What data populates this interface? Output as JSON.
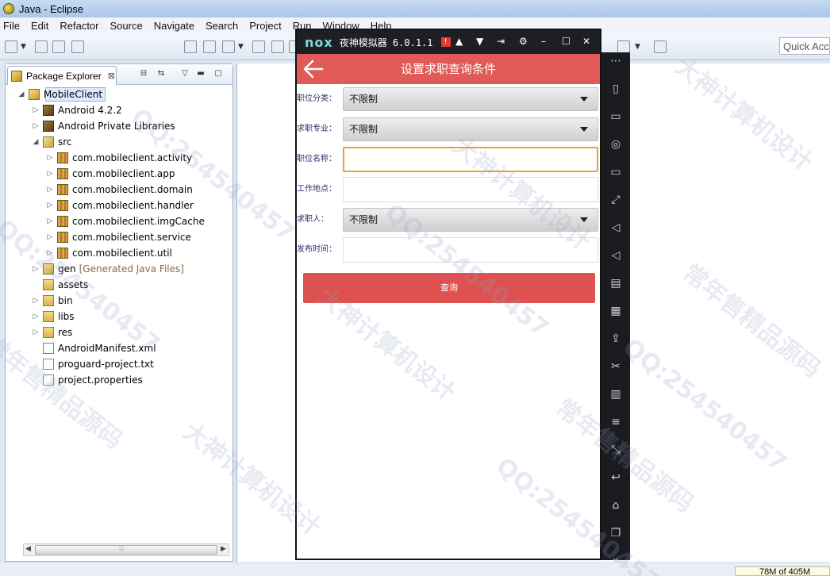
{
  "eclipse": {
    "window_title": "Java - Eclipse",
    "menu": [
      "File",
      "Edit",
      "Refactor",
      "Source",
      "Navigate",
      "Search",
      "Project",
      "Run",
      "Window",
      "Help"
    ],
    "quick_access_placeholder": "Quick Access",
    "package_explorer": {
      "tab_label": "Package Explorer",
      "close_glyph": "⊠",
      "tree": [
        {
          "label": "MobileClient",
          "icon": "project-icon",
          "twisty": "◢",
          "indent": 0
        },
        {
          "label": "Android 4.2.2",
          "icon": "library-icon",
          "twisty": "▷",
          "indent": 1
        },
        {
          "label": "Android Private Libraries",
          "icon": "library-icon",
          "twisty": "▷",
          "indent": 1
        },
        {
          "label": "src",
          "icon": "source-folder-icon",
          "twisty": "◢",
          "indent": 1
        },
        {
          "label": "com.mobileclient.activity",
          "icon": "package-icon",
          "twisty": "▷",
          "indent": 2
        },
        {
          "label": "com.mobileclient.app",
          "icon": "package-icon",
          "twisty": "▷",
          "indent": 2
        },
        {
          "label": "com.mobileclient.domain",
          "icon": "package-icon",
          "twisty": "▷",
          "indent": 2
        },
        {
          "label": "com.mobileclient.handler",
          "icon": "package-icon",
          "twisty": "▷",
          "indent": 2
        },
        {
          "label": "com.mobileclient.imgCache",
          "icon": "package-icon",
          "twisty": "▷",
          "indent": 2
        },
        {
          "label": "com.mobileclient.service",
          "icon": "package-icon",
          "twisty": "▷",
          "indent": 2
        },
        {
          "label": "com.mobileclient.util",
          "icon": "package-icon",
          "twisty": "▷",
          "indent": 2
        },
        {
          "label": "gen",
          "suffix": "[Generated Java Files]",
          "icon": "source-folder-icon",
          "twisty": "▷",
          "indent": 1
        },
        {
          "label": "assets",
          "icon": "folder-icon",
          "twisty": "",
          "indent": 1
        },
        {
          "label": "bin",
          "icon": "folder-icon",
          "twisty": "▷",
          "indent": 1
        },
        {
          "label": "libs",
          "icon": "folder-icon",
          "twisty": "▷",
          "indent": 1
        },
        {
          "label": "res",
          "icon": "folder-icon",
          "twisty": "▷",
          "indent": 1
        },
        {
          "label": "AndroidManifest.xml",
          "icon": "xml-file-icon",
          "twisty": "",
          "indent": 1
        },
        {
          "label": "proguard-project.txt",
          "icon": "file-icon",
          "twisty": "",
          "indent": 1
        },
        {
          "label": "project.properties",
          "icon": "file-icon",
          "twisty": "",
          "indent": 1
        }
      ]
    },
    "heap_status": "78M of 405M"
  },
  "nox": {
    "logo": "nox",
    "title": "夜神模拟器 6.0.1.1",
    "alert": "!",
    "toolbar_glyphs": [
      "▲",
      "▼",
      "⇥",
      "⚙",
      "–",
      "☐",
      "✕"
    ],
    "sidebar_icons": [
      {
        "name": "more-icon",
        "glyph": "⋯"
      },
      {
        "name": "shake-icon",
        "glyph": "▯"
      },
      {
        "name": "robot-icon",
        "glyph": "▭"
      },
      {
        "name": "location-icon",
        "glyph": "◎"
      },
      {
        "name": "screen-icon",
        "glyph": "▭"
      },
      {
        "name": "fullscreen-icon",
        "glyph": "⤢"
      },
      {
        "name": "volume-up-icon",
        "glyph": "◁"
      },
      {
        "name": "volume-down-icon",
        "glyph": "◁"
      },
      {
        "name": "keyboard-icon",
        "glyph": "▤"
      },
      {
        "name": "macro-icon",
        "glyph": "▦"
      },
      {
        "name": "apk-icon",
        "glyph": "⇪"
      },
      {
        "name": "scissors-icon",
        "glyph": "✂"
      },
      {
        "name": "multi-instance-icon",
        "glyph": "▥"
      },
      {
        "name": "menu-icon",
        "glyph": "≡"
      },
      {
        "name": "resize-icon",
        "glyph": "⤡"
      },
      {
        "name": "back-icon",
        "glyph": "↩"
      },
      {
        "name": "home-icon",
        "glyph": "⌂"
      },
      {
        "name": "recent-apps-icon",
        "glyph": "❐"
      },
      {
        "name": "expand-icon",
        "glyph": "»"
      }
    ]
  },
  "app": {
    "title": "设置求职查询条件",
    "fields": [
      {
        "label": "职位分类：",
        "type": "spinner",
        "value": "不限制"
      },
      {
        "label": "求职专业：",
        "type": "spinner",
        "value": "不限制"
      },
      {
        "label": "职位名称：",
        "type": "text",
        "value": "",
        "focused": true
      },
      {
        "label": "工作地点：",
        "type": "text",
        "value": ""
      },
      {
        "label": "求职人：",
        "type": "spinner",
        "value": "不限制"
      },
      {
        "label": "发布时间：",
        "type": "text",
        "value": ""
      }
    ],
    "query_button": "查询"
  },
  "watermark": {
    "qq": "QQ:254540457",
    "brand1": "大神计算机设计",
    "brand2": "常年售精品源码"
  }
}
